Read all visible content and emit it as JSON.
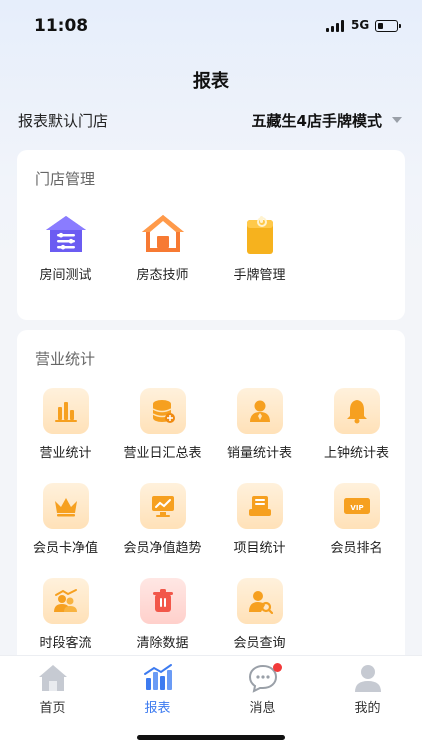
{
  "status_bar": {
    "time": "11:08",
    "network": "5G"
  },
  "header": {
    "title": "报表"
  },
  "store": {
    "label": "报表默认门店",
    "value": "五藏生4店手牌模式"
  },
  "store_management": {
    "title": "门店管理",
    "items": [
      {
        "label": "房间测试",
        "icon": "room-settings-icon"
      },
      {
        "label": "房态技师",
        "icon": "house-icon"
      },
      {
        "label": "手牌管理",
        "icon": "tag-icon"
      }
    ]
  },
  "business_stats": {
    "title": "营业统计",
    "items": [
      {
        "label": "营业统计",
        "icon": "bar-chart-icon"
      },
      {
        "label": "营业日汇总表",
        "icon": "coins-icon"
      },
      {
        "label": "销量统计表",
        "icon": "person-icon"
      },
      {
        "label": "上钟统计表",
        "icon": "bell-icon"
      },
      {
        "label": "会员卡净值",
        "icon": "crown-icon"
      },
      {
        "label": "会员净值趋势",
        "icon": "trend-monitor-icon"
      },
      {
        "label": "项目统计",
        "icon": "list-icon"
      },
      {
        "label": "会员排名",
        "icon": "vip-card-icon"
      },
      {
        "label": "时段客流",
        "icon": "people-trend-icon"
      },
      {
        "label": "清除数据",
        "icon": "trash-icon"
      },
      {
        "label": "会员查询",
        "icon": "member-search-icon"
      }
    ]
  },
  "tabbar": {
    "items": [
      {
        "label": "首页",
        "icon": "home-icon"
      },
      {
        "label": "报表",
        "icon": "report-icon"
      },
      {
        "label": "消息",
        "icon": "message-icon"
      },
      {
        "label": "我的",
        "icon": "profile-icon"
      }
    ],
    "active": "报表"
  },
  "colors": {
    "accent": "#3d7bf0",
    "icon_orange": "#f6a020",
    "badge_red": "#f23a3a"
  }
}
